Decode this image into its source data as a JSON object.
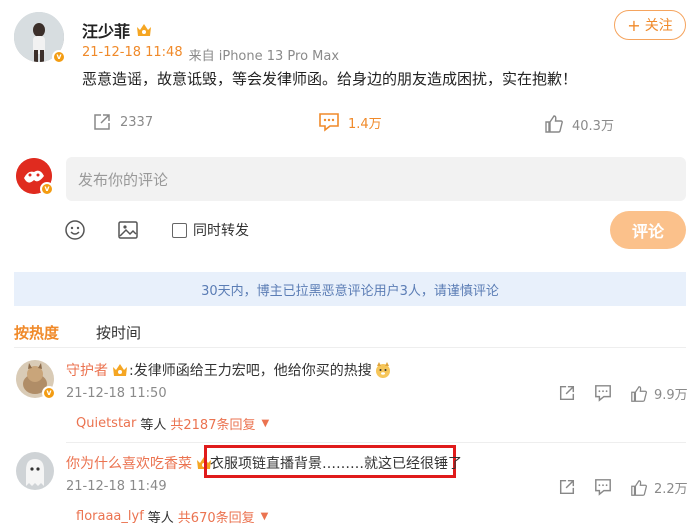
{
  "post": {
    "author": "汪少菲",
    "timestamp": "21-12-18 11:48",
    "source": "来自 iPhone 13 Pro Max",
    "follow_label": "关注",
    "content": "恶意造谣，故意诋毁，等会发律师函。给身边的朋友造成困扰，实在抱歉！",
    "repost_count": "2337",
    "comment_count": "1.4万",
    "like_count": "40.3万"
  },
  "compose": {
    "placeholder": "发布你的评论",
    "repost_checkbox_label": "同时转发",
    "submit_label": "评论"
  },
  "notice": "30天内，博主已拉黑恶意评论用户3人，请谨慎评论",
  "sort_tabs": [
    {
      "label": "按热度",
      "active": true
    },
    {
      "label": "按时间",
      "active": false
    }
  ],
  "comments": [
    {
      "username": "守护者",
      "text": "发律师函给王力宏吧，他给你买的热搜",
      "emoji": "dog-emoji",
      "timestamp": "21-12-18 11:50",
      "like_count": "9.9万",
      "reply_user": "Quietstar",
      "reply_mid": "等人",
      "reply_count": "共2187条回复"
    },
    {
      "username": "你为什么喜欢吃香菜",
      "text": "衣服项链直播背景………就这已经很锤了",
      "timestamp": "21-12-18 11:49",
      "like_count": "2.2万",
      "reply_user": "floraaa_lyf",
      "reply_mid": "等人",
      "reply_count": "共670条回复"
    }
  ],
  "colors": {
    "accent": "#f08a2a",
    "link": "#eb7350",
    "highlight": "#e01b1b",
    "notice_bg": "#e8f0fb"
  }
}
